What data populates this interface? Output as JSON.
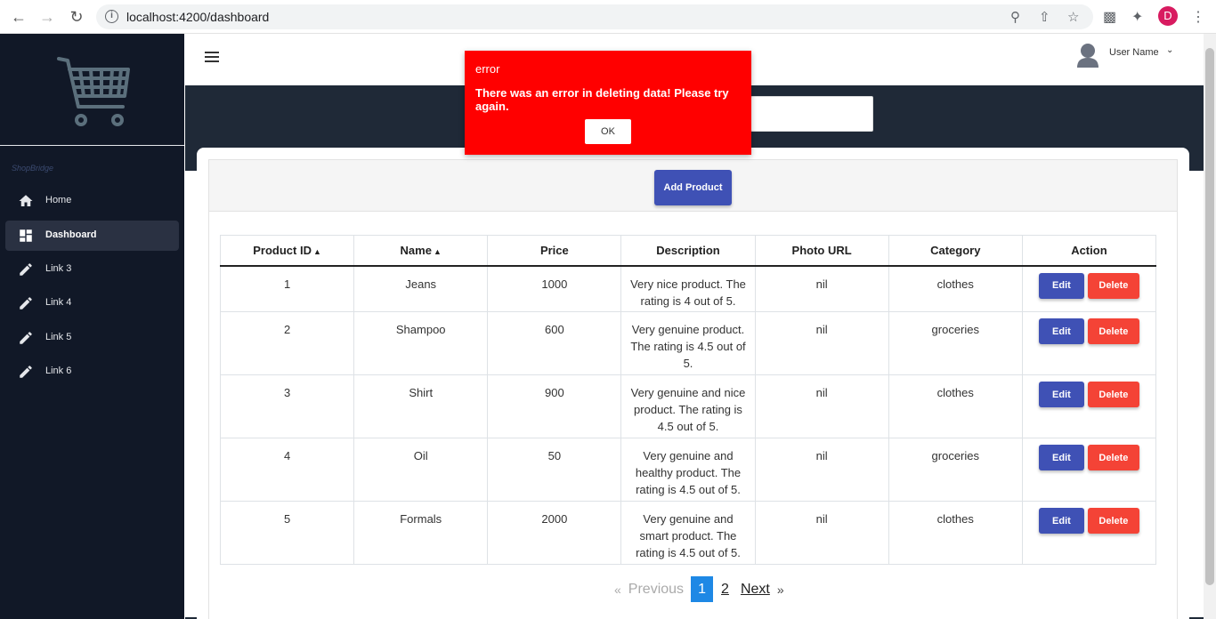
{
  "browser": {
    "url": "localhost:4200/dashboard",
    "profile_initial": "D"
  },
  "sidebar": {
    "brand": "ShopBridge",
    "items": [
      {
        "label": "Home",
        "icon": "home-icon"
      },
      {
        "label": "Dashboard",
        "icon": "dashboard-icon",
        "active": true
      },
      {
        "label": "Link 3",
        "icon": "pencil-icon"
      },
      {
        "label": "Link 4",
        "icon": "pencil-icon"
      },
      {
        "label": "Link 5",
        "icon": "pencil-icon"
      },
      {
        "label": "Link 6",
        "icon": "pencil-icon"
      }
    ]
  },
  "topbar": {
    "username": "User Name",
    "caret": "⌄"
  },
  "main": {
    "add_button": "Add Product",
    "table": {
      "columns": [
        "Product ID",
        "Name",
        "Price",
        "Description",
        "Photo URL",
        "Category",
        "Action"
      ],
      "rows": [
        {
          "id": "1",
          "name": "Jeans",
          "price": "1000",
          "description": "Very nice product. The rating is 4 out of 5.",
          "photo": "nil",
          "category": "clothes"
        },
        {
          "id": "2",
          "name": "Shampoo",
          "price": "600",
          "description": "Very genuine product. The rating is 4.5 out of 5.",
          "photo": "nil",
          "category": "groceries"
        },
        {
          "id": "3",
          "name": "Shirt",
          "price": "900",
          "description": "Very genuine and nice product. The rating is 4.5 out of 5.",
          "photo": "nil",
          "category": "clothes"
        },
        {
          "id": "4",
          "name": "Oil",
          "price": "50",
          "description": "Very genuine and healthy product. The rating is 4.5 out of 5.",
          "photo": "nil",
          "category": "groceries"
        },
        {
          "id": "5",
          "name": "Formals",
          "price": "2000",
          "description": "Very genuine and smart product. The rating is 4.5 out of 5.",
          "photo": "nil",
          "category": "clothes"
        }
      ],
      "edit_label": "Edit",
      "delete_label": "Delete"
    },
    "pagination": {
      "laquo": "«",
      "previous": "Previous",
      "current": "1",
      "page2": "2",
      "next": "Next",
      "raquo": "»"
    }
  },
  "dialog": {
    "title": "error",
    "message": "There was an error in deleting data! Please try again.",
    "ok": "OK"
  },
  "colors": {
    "sidebar_bg": "#111827",
    "hero_bg": "#1f2937",
    "primary": "#3f51b5",
    "danger": "#f44336",
    "dialog_bg": "#ff0000",
    "pager_active": "#1e88e5"
  }
}
